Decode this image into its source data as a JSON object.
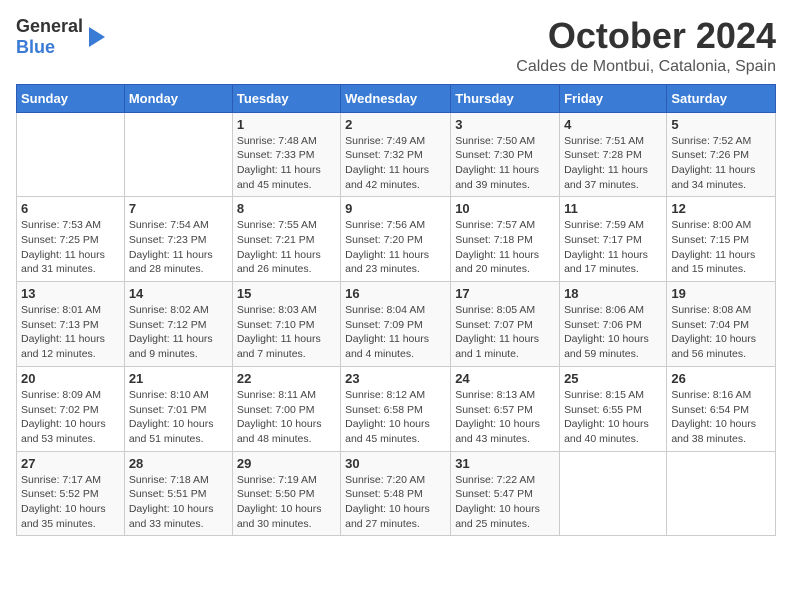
{
  "header": {
    "logo_general": "General",
    "logo_blue": "Blue",
    "month": "October 2024",
    "location": "Caldes de Montbui, Catalonia, Spain"
  },
  "weekdays": [
    "Sunday",
    "Monday",
    "Tuesday",
    "Wednesday",
    "Thursday",
    "Friday",
    "Saturday"
  ],
  "weeks": [
    [
      {
        "day": "",
        "info": ""
      },
      {
        "day": "",
        "info": ""
      },
      {
        "day": "1",
        "info": "Sunrise: 7:48 AM\nSunset: 7:33 PM\nDaylight: 11 hours and 45 minutes."
      },
      {
        "day": "2",
        "info": "Sunrise: 7:49 AM\nSunset: 7:32 PM\nDaylight: 11 hours and 42 minutes."
      },
      {
        "day": "3",
        "info": "Sunrise: 7:50 AM\nSunset: 7:30 PM\nDaylight: 11 hours and 39 minutes."
      },
      {
        "day": "4",
        "info": "Sunrise: 7:51 AM\nSunset: 7:28 PM\nDaylight: 11 hours and 37 minutes."
      },
      {
        "day": "5",
        "info": "Sunrise: 7:52 AM\nSunset: 7:26 PM\nDaylight: 11 hours and 34 minutes."
      }
    ],
    [
      {
        "day": "6",
        "info": "Sunrise: 7:53 AM\nSunset: 7:25 PM\nDaylight: 11 hours and 31 minutes."
      },
      {
        "day": "7",
        "info": "Sunrise: 7:54 AM\nSunset: 7:23 PM\nDaylight: 11 hours and 28 minutes."
      },
      {
        "day": "8",
        "info": "Sunrise: 7:55 AM\nSunset: 7:21 PM\nDaylight: 11 hours and 26 minutes."
      },
      {
        "day": "9",
        "info": "Sunrise: 7:56 AM\nSunset: 7:20 PM\nDaylight: 11 hours and 23 minutes."
      },
      {
        "day": "10",
        "info": "Sunrise: 7:57 AM\nSunset: 7:18 PM\nDaylight: 11 hours and 20 minutes."
      },
      {
        "day": "11",
        "info": "Sunrise: 7:59 AM\nSunset: 7:17 PM\nDaylight: 11 hours and 17 minutes."
      },
      {
        "day": "12",
        "info": "Sunrise: 8:00 AM\nSunset: 7:15 PM\nDaylight: 11 hours and 15 minutes."
      }
    ],
    [
      {
        "day": "13",
        "info": "Sunrise: 8:01 AM\nSunset: 7:13 PM\nDaylight: 11 hours and 12 minutes."
      },
      {
        "day": "14",
        "info": "Sunrise: 8:02 AM\nSunset: 7:12 PM\nDaylight: 11 hours and 9 minutes."
      },
      {
        "day": "15",
        "info": "Sunrise: 8:03 AM\nSunset: 7:10 PM\nDaylight: 11 hours and 7 minutes."
      },
      {
        "day": "16",
        "info": "Sunrise: 8:04 AM\nSunset: 7:09 PM\nDaylight: 11 hours and 4 minutes."
      },
      {
        "day": "17",
        "info": "Sunrise: 8:05 AM\nSunset: 7:07 PM\nDaylight: 11 hours and 1 minute."
      },
      {
        "day": "18",
        "info": "Sunrise: 8:06 AM\nSunset: 7:06 PM\nDaylight: 10 hours and 59 minutes."
      },
      {
        "day": "19",
        "info": "Sunrise: 8:08 AM\nSunset: 7:04 PM\nDaylight: 10 hours and 56 minutes."
      }
    ],
    [
      {
        "day": "20",
        "info": "Sunrise: 8:09 AM\nSunset: 7:02 PM\nDaylight: 10 hours and 53 minutes."
      },
      {
        "day": "21",
        "info": "Sunrise: 8:10 AM\nSunset: 7:01 PM\nDaylight: 10 hours and 51 minutes."
      },
      {
        "day": "22",
        "info": "Sunrise: 8:11 AM\nSunset: 7:00 PM\nDaylight: 10 hours and 48 minutes."
      },
      {
        "day": "23",
        "info": "Sunrise: 8:12 AM\nSunset: 6:58 PM\nDaylight: 10 hours and 45 minutes."
      },
      {
        "day": "24",
        "info": "Sunrise: 8:13 AM\nSunset: 6:57 PM\nDaylight: 10 hours and 43 minutes."
      },
      {
        "day": "25",
        "info": "Sunrise: 8:15 AM\nSunset: 6:55 PM\nDaylight: 10 hours and 40 minutes."
      },
      {
        "day": "26",
        "info": "Sunrise: 8:16 AM\nSunset: 6:54 PM\nDaylight: 10 hours and 38 minutes."
      }
    ],
    [
      {
        "day": "27",
        "info": "Sunrise: 7:17 AM\nSunset: 5:52 PM\nDaylight: 10 hours and 35 minutes."
      },
      {
        "day": "28",
        "info": "Sunrise: 7:18 AM\nSunset: 5:51 PM\nDaylight: 10 hours and 33 minutes."
      },
      {
        "day": "29",
        "info": "Sunrise: 7:19 AM\nSunset: 5:50 PM\nDaylight: 10 hours and 30 minutes."
      },
      {
        "day": "30",
        "info": "Sunrise: 7:20 AM\nSunset: 5:48 PM\nDaylight: 10 hours and 27 minutes."
      },
      {
        "day": "31",
        "info": "Sunrise: 7:22 AM\nSunset: 5:47 PM\nDaylight: 10 hours and 25 minutes."
      },
      {
        "day": "",
        "info": ""
      },
      {
        "day": "",
        "info": ""
      }
    ]
  ]
}
